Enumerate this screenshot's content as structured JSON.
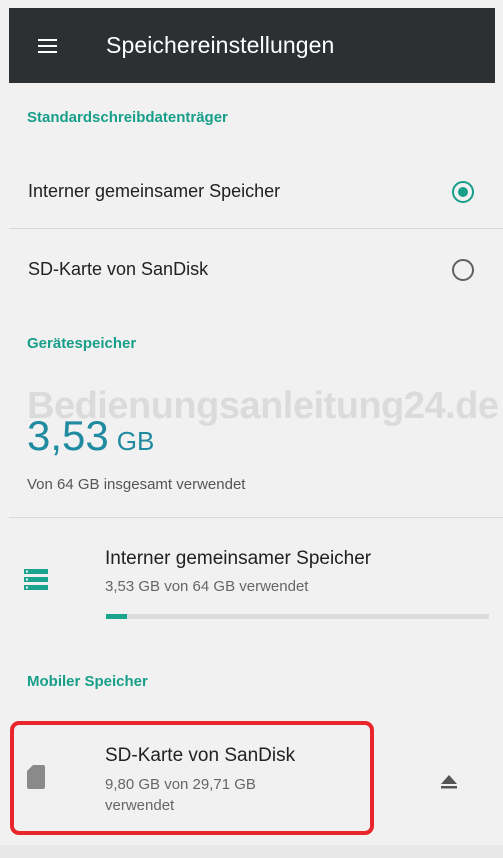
{
  "appbar": {
    "menu_icon": "hamburger-menu-icon",
    "title": "Speichereinstellungen"
  },
  "default_write": {
    "header": "Standardschreibdatenträger",
    "options": [
      {
        "label": "Interner gemeinsamer Speicher",
        "selected": true
      },
      {
        "label": "SD-Karte von SanDisk",
        "selected": false
      }
    ]
  },
  "device_storage": {
    "header": "Gerätespeicher",
    "used_value": "3,53",
    "used_unit": "GB",
    "caption": "Von 64 GB insgesamt verwendet",
    "watermark": "Bedienungsanleitung24.de",
    "item": {
      "icon": "storage-list-icon",
      "title": "Interner gemeinsamer Speicher",
      "subtitle": "3,53 GB von 64 GB verwendet",
      "usage_fraction": 0.0552,
      "accent_color": "#1aa48e"
    }
  },
  "portable_storage": {
    "header": "Mobiler Speicher",
    "item": {
      "icon": "sd-card-icon",
      "title": "SD-Karte von SanDisk",
      "subtitle_line1": "9,80 GB von 29,71 GB",
      "subtitle_line2": "verwendet",
      "action_icon": "eject-icon",
      "highlight_color": "#e8262b"
    }
  }
}
